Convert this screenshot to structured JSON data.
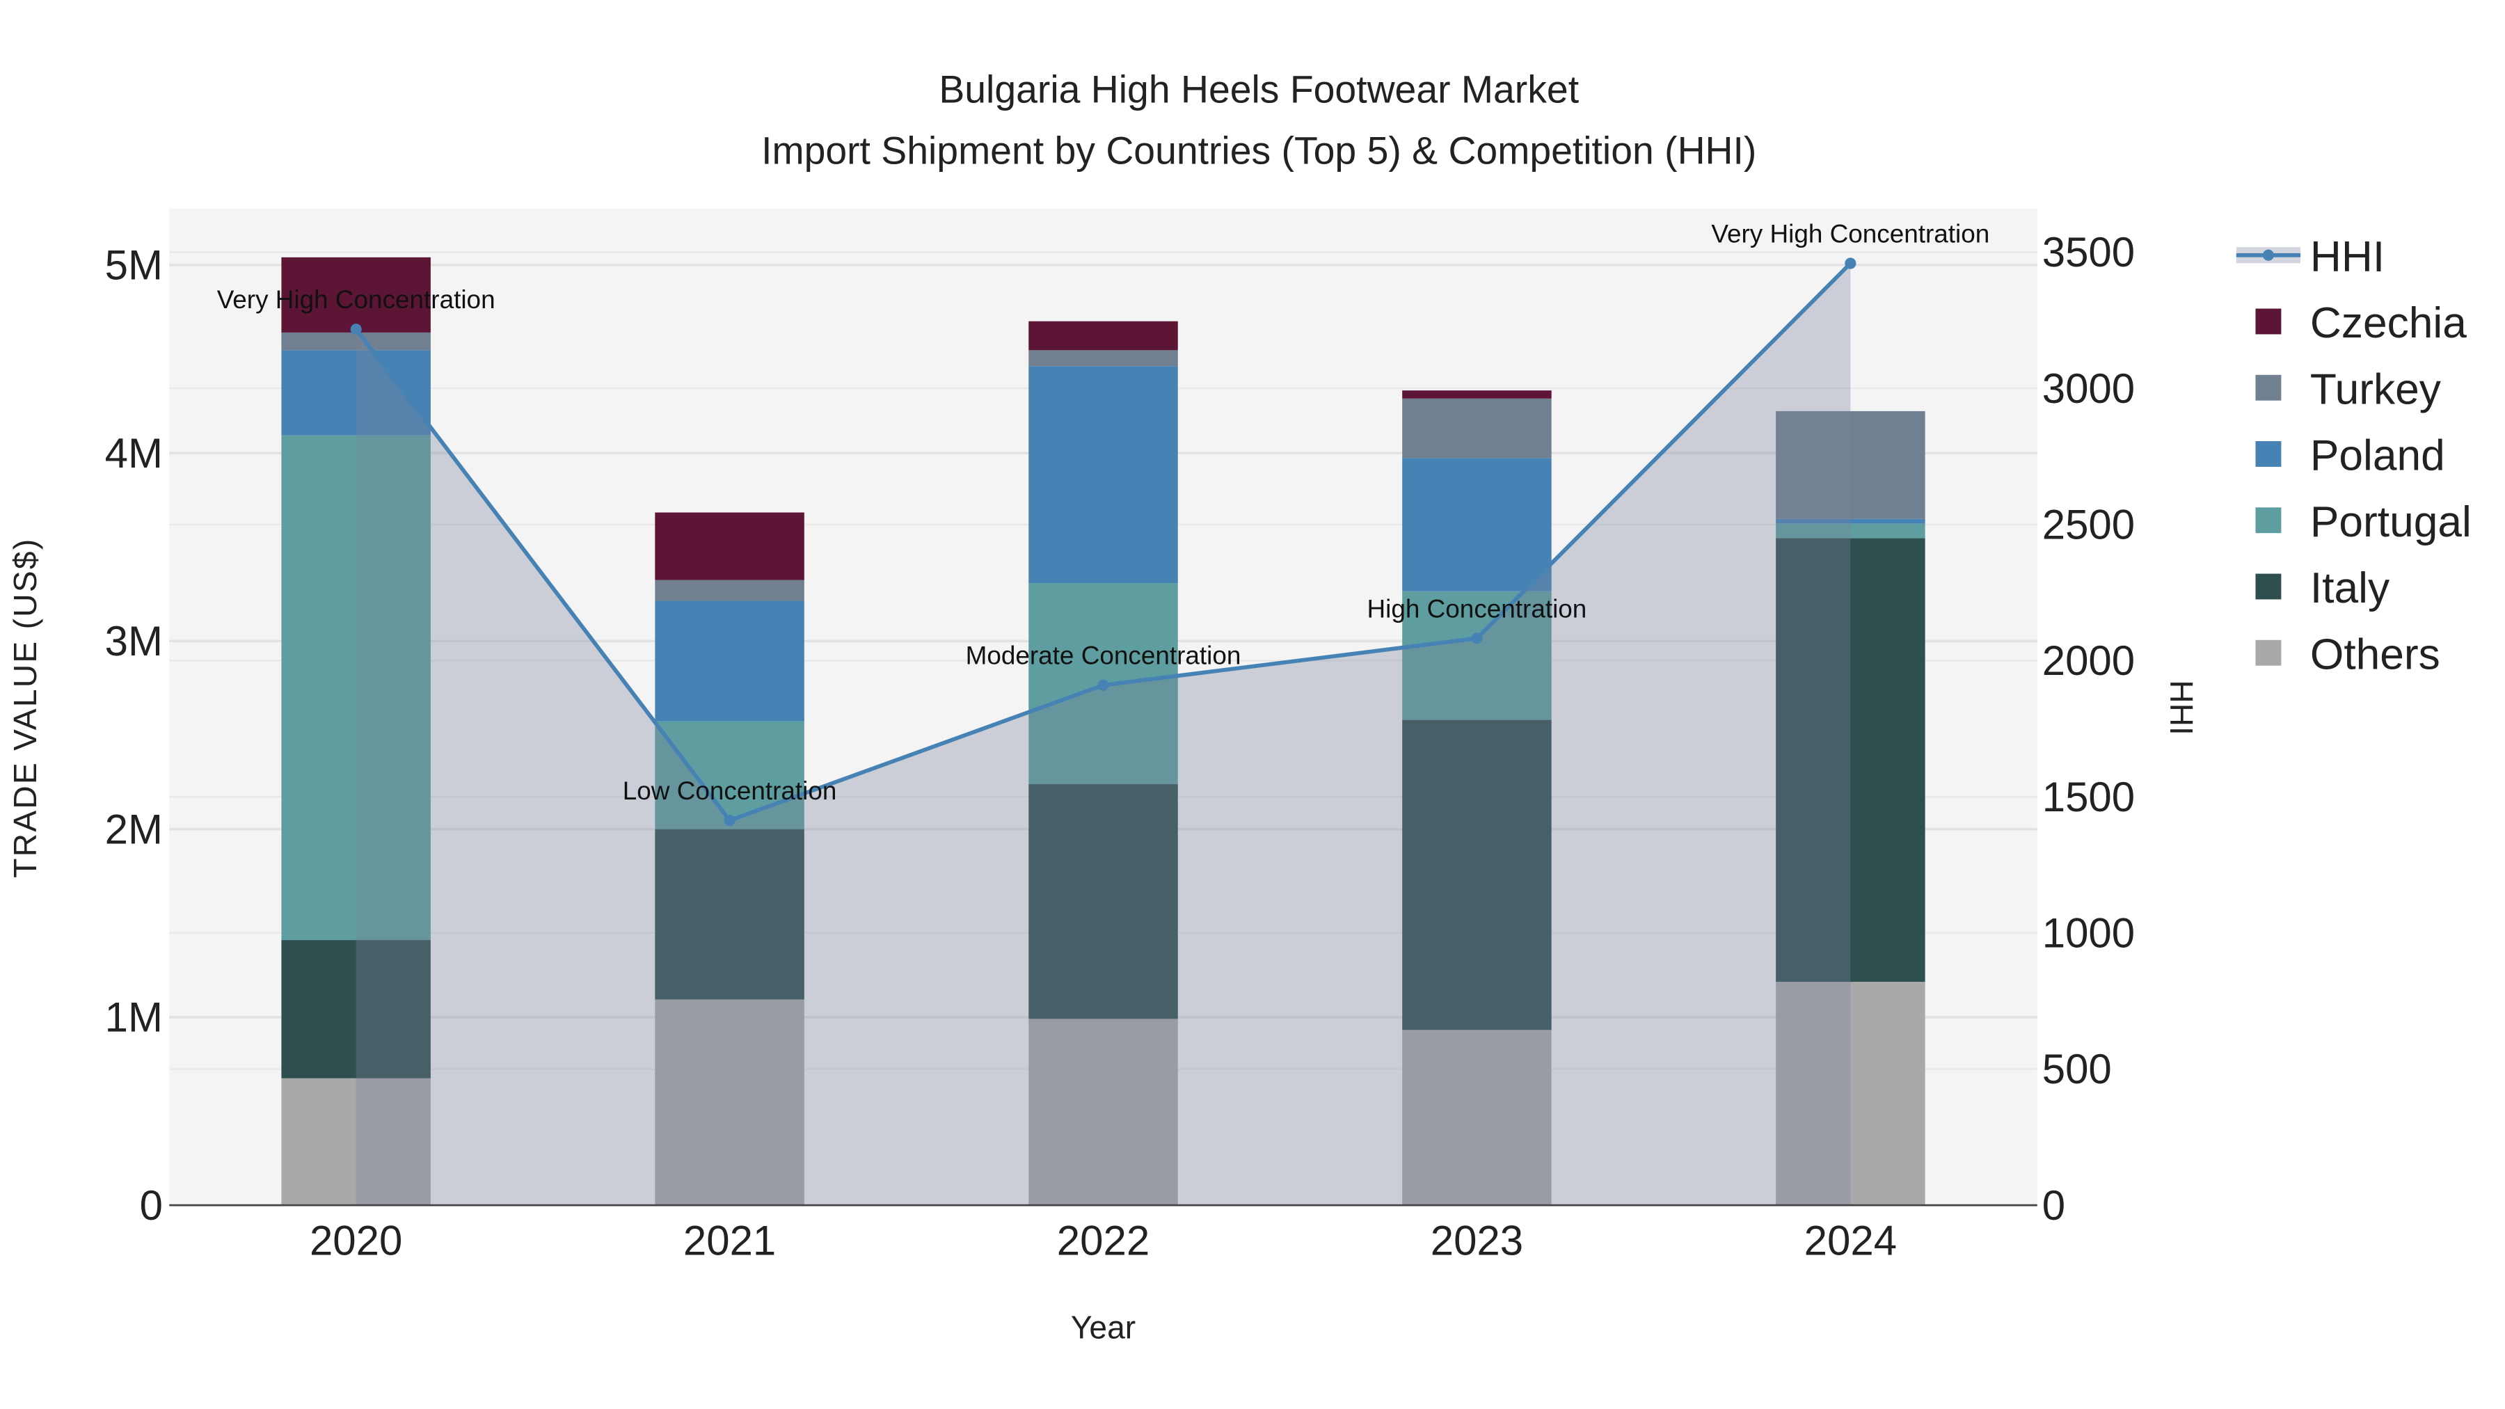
{
  "chart_data": {
    "type": "bar",
    "title": "Bulgaria High Heels Footwear Market",
    "subtitle": "Import Shipment by Countries (Top 5) & Competition (HHI)",
    "xlabel": "Year",
    "ylabel": "TRADE VALUE (US$)",
    "y2label": "HHI",
    "categories": [
      "2020",
      "2021",
      "2022",
      "2023",
      "2024"
    ],
    "ylim": [
      0,
      5300000
    ],
    "y2lim": [
      0,
      3660
    ],
    "yticks": [
      0,
      1000000,
      2000000,
      3000000,
      4000000,
      5000000
    ],
    "ytick_labels": [
      "0",
      "1M",
      "2M",
      "3M",
      "4M",
      "5M"
    ],
    "y2ticks": [
      0,
      500,
      1000,
      1500,
      2000,
      2500,
      3000,
      3500
    ],
    "y2tick_labels": [
      "0",
      "500",
      "1000",
      "1500",
      "2000",
      "2500",
      "3000",
      "3500"
    ],
    "grid": true,
    "legend_position": "right",
    "series": [
      {
        "name": "Others",
        "color": "#a9a9a9",
        "values": [
          675000,
          1094000,
          991000,
          932000,
          1188000
        ]
      },
      {
        "name": "Italy",
        "color": "#2f4f4f",
        "values": [
          735000,
          906000,
          1248000,
          1649000,
          2359000
        ]
      },
      {
        "name": "Portugal",
        "color": "#5f9ea0",
        "values": [
          2684000,
          573000,
          1069000,
          684000,
          77000
        ]
      },
      {
        "name": "Poland",
        "color": "#4682b4",
        "values": [
          453000,
          641000,
          1154000,
          709000,
          26000
        ]
      },
      {
        "name": "Turkey",
        "color": "#708090",
        "values": [
          94000,
          111000,
          85000,
          316000,
          573000
        ]
      },
      {
        "name": "Czechia",
        "color": "#5c1535",
        "values": [
          400000,
          359000,
          154000,
          43000,
          0
        ]
      }
    ],
    "hhi": {
      "name": "HHI",
      "color": "#4682b4",
      "values": [
        3217,
        1413,
        1910,
        2082,
        3459
      ],
      "annotations": [
        "Very High Concentration",
        "Low Concentration",
        "Moderate Concentration",
        "High Concentration",
        "Very High Concentration"
      ]
    },
    "legend_order": [
      "HHI",
      "Czechia",
      "Turkey",
      "Poland",
      "Portugal",
      "Italy",
      "Others"
    ]
  }
}
